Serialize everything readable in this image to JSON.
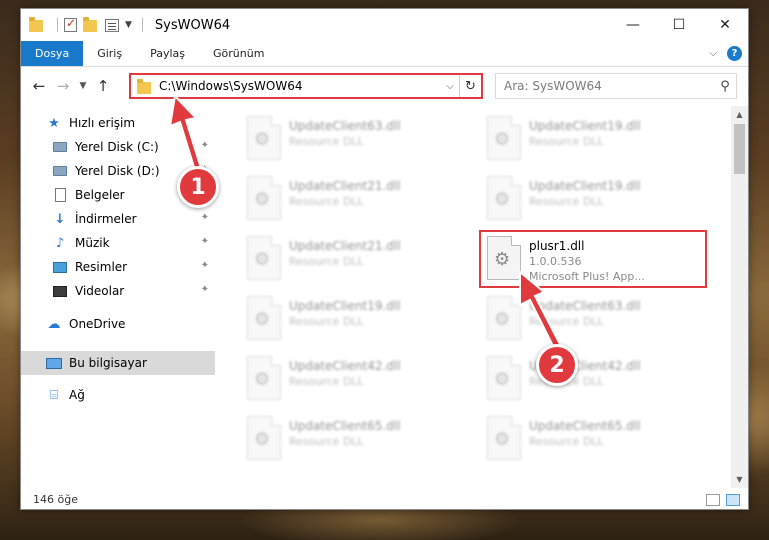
{
  "window": {
    "title": "SysWOW64",
    "controls": {
      "minimize": "—",
      "maximize": "☐",
      "close": "✕"
    }
  },
  "ribbon": {
    "tabs": [
      "Dosya",
      "Giriş",
      "Paylaş",
      "Görünüm"
    ],
    "help": "?"
  },
  "nav": {
    "address": "C:\\Windows\\SysWOW64",
    "search_placeholder": "Ara: SysWOW64"
  },
  "sidebar": {
    "items": [
      {
        "label": "Hızlı erişim"
      },
      {
        "label": "Yerel Disk (C:)"
      },
      {
        "label": "Yerel Disk (D:)"
      },
      {
        "label": "Belgeler"
      },
      {
        "label": "İndirmeler"
      },
      {
        "label": "Müzik"
      },
      {
        "label": "Resimler"
      },
      {
        "label": "Videolar"
      },
      {
        "label": "OneDrive"
      },
      {
        "label": "Bu bilgisayar"
      },
      {
        "label": "Ağ"
      }
    ]
  },
  "files": {
    "items": [
      {
        "name": "UpdateClient63.dll",
        "sub": "Resource DLL"
      },
      {
        "name": "UpdateClient19.dll",
        "sub": "Resource DLL"
      },
      {
        "name": "UpdateClient21.dll",
        "sub": "Resource DLL"
      },
      {
        "name": "UpdateClient19.dll",
        "sub": "Resource DLL"
      },
      {
        "name": "UpdateClient21.dll",
        "sub": "Resource DLL"
      },
      {
        "name": "plusr1.dll",
        "sub": "1.0.0.536",
        "sub2": "Microsoft Plus! App..."
      },
      {
        "name": "UpdateClient19.dll",
        "sub": "Resource DLL"
      },
      {
        "name": "UpdateClient63.dll",
        "sub": "Resource DLL"
      },
      {
        "name": "UpdateClient42.dll",
        "sub": "Resource DLL"
      },
      {
        "name": "UpdateClient42.dll",
        "sub": "Resource DLL"
      },
      {
        "name": "UpdateClient65.dll",
        "sub": "Resource DLL"
      },
      {
        "name": "UpdateClient65.dll",
        "sub": "Resource DLL"
      }
    ]
  },
  "status": {
    "count": "146 öğe"
  },
  "annotations": {
    "step1": "1",
    "step2": "2",
    "color": "#e0393e"
  }
}
